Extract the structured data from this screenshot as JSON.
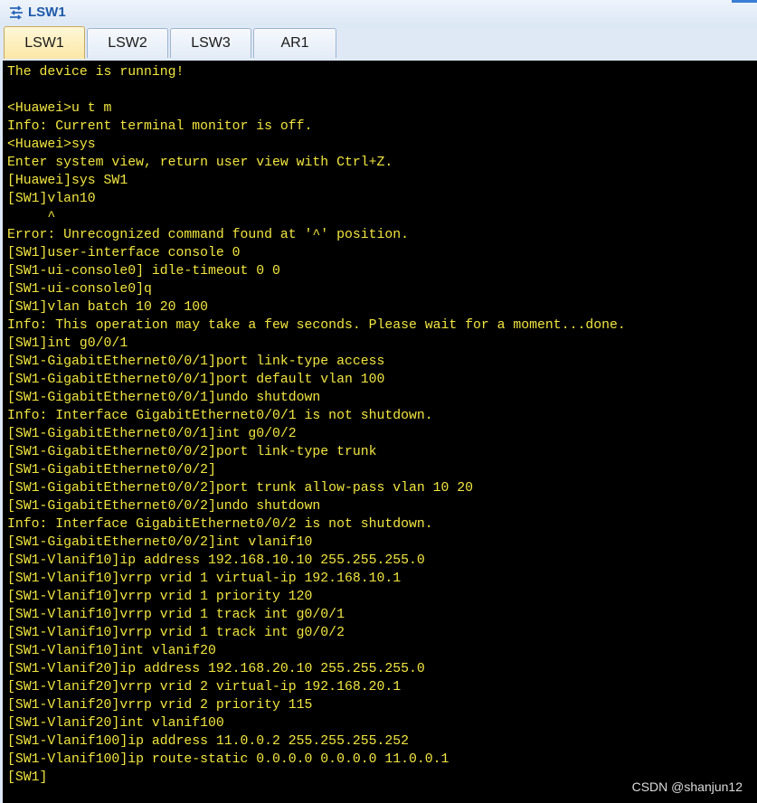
{
  "window": {
    "title": "LSW1",
    "icon": "switch-icon"
  },
  "tabs": [
    {
      "label": "LSW1",
      "active": true
    },
    {
      "label": "LSW2",
      "active": false
    },
    {
      "label": "LSW3",
      "active": false
    },
    {
      "label": "AR1",
      "active": false
    }
  ],
  "terminal": {
    "text_color": "#f2e640",
    "background": "#000000",
    "lines": [
      "The device is running!",
      "",
      "<Huawei>u t m",
      "Info: Current terminal monitor is off.",
      "<Huawei>sys",
      "Enter system view, return user view with Ctrl+Z.",
      "[Huawei]sys SW1",
      "[SW1]vlan10",
      "     ^",
      "Error: Unrecognized command found at '^' position.",
      "[SW1]user-interface console 0",
      "[SW1-ui-console0] idle-timeout 0 0",
      "[SW1-ui-console0]q",
      "[SW1]vlan batch 10 20 100",
      "Info: This operation may take a few seconds. Please wait for a moment...done.",
      "[SW1]int g0/0/1",
      "[SW1-GigabitEthernet0/0/1]port link-type access",
      "[SW1-GigabitEthernet0/0/1]port default vlan 100",
      "[SW1-GigabitEthernet0/0/1]undo shutdown",
      "Info: Interface GigabitEthernet0/0/1 is not shutdown.",
      "[SW1-GigabitEthernet0/0/1]int g0/0/2",
      "[SW1-GigabitEthernet0/0/2]port link-type trunk",
      "[SW1-GigabitEthernet0/0/2]",
      "[SW1-GigabitEthernet0/0/2]port trunk allow-pass vlan 10 20",
      "[SW1-GigabitEthernet0/0/2]undo shutdown",
      "Info: Interface GigabitEthernet0/0/2 is not shutdown.",
      "[SW1-GigabitEthernet0/0/2]int vlanif10",
      "[SW1-Vlanif10]ip address 192.168.10.10 255.255.255.0",
      "[SW1-Vlanif10]vrrp vrid 1 virtual-ip 192.168.10.1",
      "[SW1-Vlanif10]vrrp vrid 1 priority 120",
      "[SW1-Vlanif10]vrrp vrid 1 track int g0/0/1",
      "[SW1-Vlanif10]vrrp vrid 1 track int g0/0/2",
      "[SW1-Vlanif10]int vlanif20",
      "[SW1-Vlanif20]ip address 192.168.20.10 255.255.255.0",
      "[SW1-Vlanif20]vrrp vrid 2 virtual-ip 192.168.20.1",
      "[SW1-Vlanif20]vrrp vrid 2 priority 115",
      "[SW1-Vlanif20]int vlanif100",
      "[SW1-Vlanif100]ip address 11.0.0.2 255.255.255.252",
      "[SW1-Vlanif100]ip route-static 0.0.0.0 0.0.0.0 11.0.0.1",
      "[SW1]"
    ]
  },
  "watermark": "CSDN @shanjun12"
}
